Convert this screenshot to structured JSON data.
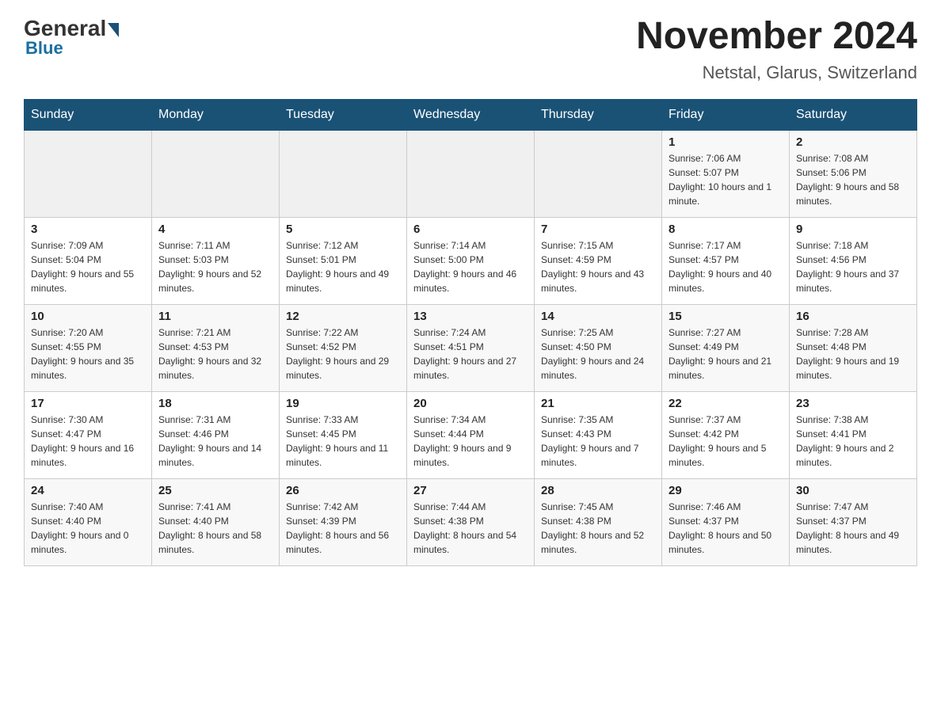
{
  "header": {
    "logo_general": "General",
    "logo_blue": "Blue",
    "month_title": "November 2024",
    "location": "Netstal, Glarus, Switzerland"
  },
  "calendar": {
    "days_of_week": [
      "Sunday",
      "Monday",
      "Tuesday",
      "Wednesday",
      "Thursday",
      "Friday",
      "Saturday"
    ],
    "weeks": [
      [
        {
          "day": "",
          "info": ""
        },
        {
          "day": "",
          "info": ""
        },
        {
          "day": "",
          "info": ""
        },
        {
          "day": "",
          "info": ""
        },
        {
          "day": "",
          "info": ""
        },
        {
          "day": "1",
          "info": "Sunrise: 7:06 AM\nSunset: 5:07 PM\nDaylight: 10 hours and 1 minute."
        },
        {
          "day": "2",
          "info": "Sunrise: 7:08 AM\nSunset: 5:06 PM\nDaylight: 9 hours and 58 minutes."
        }
      ],
      [
        {
          "day": "3",
          "info": "Sunrise: 7:09 AM\nSunset: 5:04 PM\nDaylight: 9 hours and 55 minutes."
        },
        {
          "day": "4",
          "info": "Sunrise: 7:11 AM\nSunset: 5:03 PM\nDaylight: 9 hours and 52 minutes."
        },
        {
          "day": "5",
          "info": "Sunrise: 7:12 AM\nSunset: 5:01 PM\nDaylight: 9 hours and 49 minutes."
        },
        {
          "day": "6",
          "info": "Sunrise: 7:14 AM\nSunset: 5:00 PM\nDaylight: 9 hours and 46 minutes."
        },
        {
          "day": "7",
          "info": "Sunrise: 7:15 AM\nSunset: 4:59 PM\nDaylight: 9 hours and 43 minutes."
        },
        {
          "day": "8",
          "info": "Sunrise: 7:17 AM\nSunset: 4:57 PM\nDaylight: 9 hours and 40 minutes."
        },
        {
          "day": "9",
          "info": "Sunrise: 7:18 AM\nSunset: 4:56 PM\nDaylight: 9 hours and 37 minutes."
        }
      ],
      [
        {
          "day": "10",
          "info": "Sunrise: 7:20 AM\nSunset: 4:55 PM\nDaylight: 9 hours and 35 minutes."
        },
        {
          "day": "11",
          "info": "Sunrise: 7:21 AM\nSunset: 4:53 PM\nDaylight: 9 hours and 32 minutes."
        },
        {
          "day": "12",
          "info": "Sunrise: 7:22 AM\nSunset: 4:52 PM\nDaylight: 9 hours and 29 minutes."
        },
        {
          "day": "13",
          "info": "Sunrise: 7:24 AM\nSunset: 4:51 PM\nDaylight: 9 hours and 27 minutes."
        },
        {
          "day": "14",
          "info": "Sunrise: 7:25 AM\nSunset: 4:50 PM\nDaylight: 9 hours and 24 minutes."
        },
        {
          "day": "15",
          "info": "Sunrise: 7:27 AM\nSunset: 4:49 PM\nDaylight: 9 hours and 21 minutes."
        },
        {
          "day": "16",
          "info": "Sunrise: 7:28 AM\nSunset: 4:48 PM\nDaylight: 9 hours and 19 minutes."
        }
      ],
      [
        {
          "day": "17",
          "info": "Sunrise: 7:30 AM\nSunset: 4:47 PM\nDaylight: 9 hours and 16 minutes."
        },
        {
          "day": "18",
          "info": "Sunrise: 7:31 AM\nSunset: 4:46 PM\nDaylight: 9 hours and 14 minutes."
        },
        {
          "day": "19",
          "info": "Sunrise: 7:33 AM\nSunset: 4:45 PM\nDaylight: 9 hours and 11 minutes."
        },
        {
          "day": "20",
          "info": "Sunrise: 7:34 AM\nSunset: 4:44 PM\nDaylight: 9 hours and 9 minutes."
        },
        {
          "day": "21",
          "info": "Sunrise: 7:35 AM\nSunset: 4:43 PM\nDaylight: 9 hours and 7 minutes."
        },
        {
          "day": "22",
          "info": "Sunrise: 7:37 AM\nSunset: 4:42 PM\nDaylight: 9 hours and 5 minutes."
        },
        {
          "day": "23",
          "info": "Sunrise: 7:38 AM\nSunset: 4:41 PM\nDaylight: 9 hours and 2 minutes."
        }
      ],
      [
        {
          "day": "24",
          "info": "Sunrise: 7:40 AM\nSunset: 4:40 PM\nDaylight: 9 hours and 0 minutes."
        },
        {
          "day": "25",
          "info": "Sunrise: 7:41 AM\nSunset: 4:40 PM\nDaylight: 8 hours and 58 minutes."
        },
        {
          "day": "26",
          "info": "Sunrise: 7:42 AM\nSunset: 4:39 PM\nDaylight: 8 hours and 56 minutes."
        },
        {
          "day": "27",
          "info": "Sunrise: 7:44 AM\nSunset: 4:38 PM\nDaylight: 8 hours and 54 minutes."
        },
        {
          "day": "28",
          "info": "Sunrise: 7:45 AM\nSunset: 4:38 PM\nDaylight: 8 hours and 52 minutes."
        },
        {
          "day": "29",
          "info": "Sunrise: 7:46 AM\nSunset: 4:37 PM\nDaylight: 8 hours and 50 minutes."
        },
        {
          "day": "30",
          "info": "Sunrise: 7:47 AM\nSunset: 4:37 PM\nDaylight: 8 hours and 49 minutes."
        }
      ]
    ]
  }
}
